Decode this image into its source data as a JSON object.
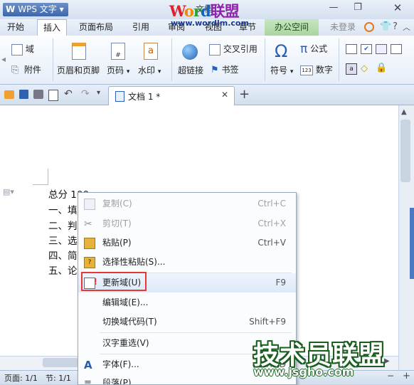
{
  "app": {
    "title": "WPS 文字",
    "logo_letter": "W"
  },
  "watermark_top": {
    "w1": "W",
    "w2": "o",
    "w3": "r",
    "w4": "d",
    "w5": "联盟",
    "url": "www.wordlm.com"
  },
  "title_hidden_text": "文档",
  "menu_tabs": [
    "开始",
    "插入",
    "页面布局",
    "引用",
    "审阅",
    "视图",
    "章节",
    "办公空间",
    "未登录"
  ],
  "ribbon": {
    "field": "域",
    "attachment": "附件",
    "header_footer": "页眉和页脚",
    "page_number": "页码",
    "watermark": "水印",
    "hyperlink": "超链接",
    "cross_ref": "交叉引用",
    "bookmark": "书签",
    "symbol": "符号",
    "formula": "公式",
    "number": "数字"
  },
  "doc_tab": {
    "label": "文档 1 *"
  },
  "document": {
    "lines": [
      "总分 100",
      "一、填",
      "二、判",
      "三、选",
      "四、简",
      "五、论"
    ]
  },
  "context_menu": {
    "items": [
      {
        "label": "复制(C)",
        "shortcut": "Ctrl+C",
        "icon": "copy-icon",
        "disabled": true
      },
      {
        "label": "剪切(T)",
        "shortcut": "Ctrl+X",
        "icon": "cut-icon",
        "disabled": true
      },
      {
        "label": "粘贴(P)",
        "shortcut": "Ctrl+V",
        "icon": "paste-icon",
        "disabled": false
      },
      {
        "label": "选择性粘贴(S)...",
        "shortcut": "",
        "icon": "paste-special-icon",
        "disabled": false
      },
      {
        "label": "更新域(U)",
        "shortcut": "F9",
        "icon": "update-field-icon",
        "disabled": false
      },
      {
        "label": "编辑域(E)...",
        "shortcut": "",
        "icon": "",
        "disabled": false
      },
      {
        "label": "切换域代码(T)",
        "shortcut": "Shift+F9",
        "icon": "",
        "disabled": false
      },
      {
        "label": "汉字重选(V)",
        "shortcut": "",
        "icon": "",
        "disabled": false
      },
      {
        "label": "字体(F)...",
        "shortcut": "Ctrl+D",
        "icon": "font-icon",
        "disabled": false
      },
      {
        "label": "段落(P)...",
        "shortcut": "",
        "icon": "paragraph-icon",
        "disabled": false
      }
    ]
  },
  "status": {
    "page": "页面: 1/1",
    "section": "节: 1/1"
  },
  "watermark_bottom": {
    "text": "技术员联盟",
    "url": "www.jsgho.com"
  },
  "colors": {
    "highlight_box": "#e53935",
    "office_tab": "#a9d59f",
    "accent_blue": "#3d66ad"
  }
}
